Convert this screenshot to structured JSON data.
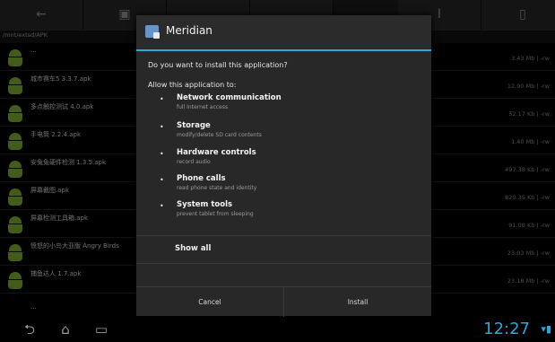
{
  "toolbar": {
    "buttons": [
      {
        "icon": "back-arrow-icon",
        "glyph": "←"
      },
      {
        "icon": "sd-card-icon",
        "glyph": "▣"
      },
      {
        "icon": "folder-icon",
        "glyph": ""
      },
      {
        "icon": "unknown-icon",
        "glyph": ""
      },
      {
        "icon": "tools-icon",
        "glyph": "Ⅰ"
      },
      {
        "icon": "file-icon",
        "glyph": "▯"
      }
    ]
  },
  "path": "/mnt/extsd/APK",
  "files": [
    {
      "name": "...",
      "size": "3.43 Mb | -rw"
    },
    {
      "name": "城市赛车5 3.3.7.apk",
      "size": "12.90 Mb | -rw"
    },
    {
      "name": "多点触控测试 4.0.apk",
      "size": "52.17 Kb | -rw"
    },
    {
      "name": "手电筒 2.2.4.apk",
      "size": "1.40 Mb | -rw"
    },
    {
      "name": "安兔兔硬件检测 1.3.5.apk",
      "size": "497.38 Kb | -rw"
    },
    {
      "name": "屏幕截图.apk",
      "size": "820.35 Kb | -rw"
    },
    {
      "name": "屏幕检测工具箱.apk",
      "size": "91.08 Kb | -rw"
    },
    {
      "name": "愤怒的小鸟大亚版 Angry Birds",
      "size": "23.03 Mb | -rw"
    },
    {
      "name": "捕鱼达人 1.7.apk",
      "size": "23.18 Mb | -rw"
    },
    {
      "name": "...",
      "size": ""
    }
  ],
  "dialog": {
    "app_name": "Meridian",
    "question": "Do you want to install this application?",
    "permissions_heading": "Allow this application to:",
    "permissions": [
      {
        "title": "Network communication",
        "desc": "full Internet access"
      },
      {
        "title": "Storage",
        "desc": "modify/delete SD card contents"
      },
      {
        "title": "Hardware controls",
        "desc": "record audio"
      },
      {
        "title": "Phone calls",
        "desc": "read phone state and identity"
      },
      {
        "title": "System tools",
        "desc": "prevent tablet from sleeping"
      }
    ],
    "show_all": "Show all",
    "cancel": "Cancel",
    "install": "Install"
  },
  "nav": {
    "back_icon": "back-icon",
    "home_icon": "home-icon",
    "recents_icon": "recent-apps-icon",
    "clock": "12:27",
    "status": "wifi-icon battery-icon"
  },
  "colors": {
    "accent": "#2aa7d6",
    "apk_green": "#7da82f",
    "dialog_bg": "#282828"
  }
}
